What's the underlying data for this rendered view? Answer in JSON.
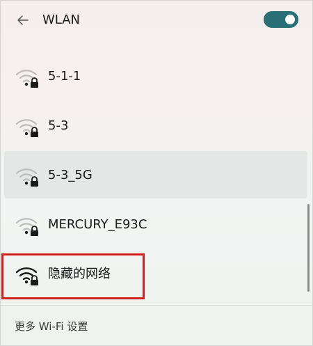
{
  "header": {
    "back_icon": "arrow-left-icon",
    "title": "WLAN",
    "toggle_state": "on",
    "toggle_color": "#2b6f76"
  },
  "networks": [
    {
      "name": "5-1-1",
      "icon": "wifi-lock-icon",
      "signal": "weak",
      "hovered": false
    },
    {
      "name": "5-3",
      "icon": "wifi-lock-icon",
      "signal": "weak",
      "hovered": false
    },
    {
      "name": "5-3_5G",
      "icon": "wifi-lock-icon",
      "signal": "weak",
      "hovered": true
    },
    {
      "name": "MERCURY_E93C",
      "icon": "wifi-lock-icon",
      "signal": "weak",
      "hovered": false
    },
    {
      "name": "隐藏的网络",
      "icon": "wifi-lock-icon",
      "signal": "strong",
      "hovered": false,
      "highlighted": true
    }
  ],
  "footer": {
    "link_label": "更多 Wi-Fi 设置"
  },
  "colors": {
    "highlight_border": "#d51f1f",
    "hover_row": "#e1e7e6"
  }
}
